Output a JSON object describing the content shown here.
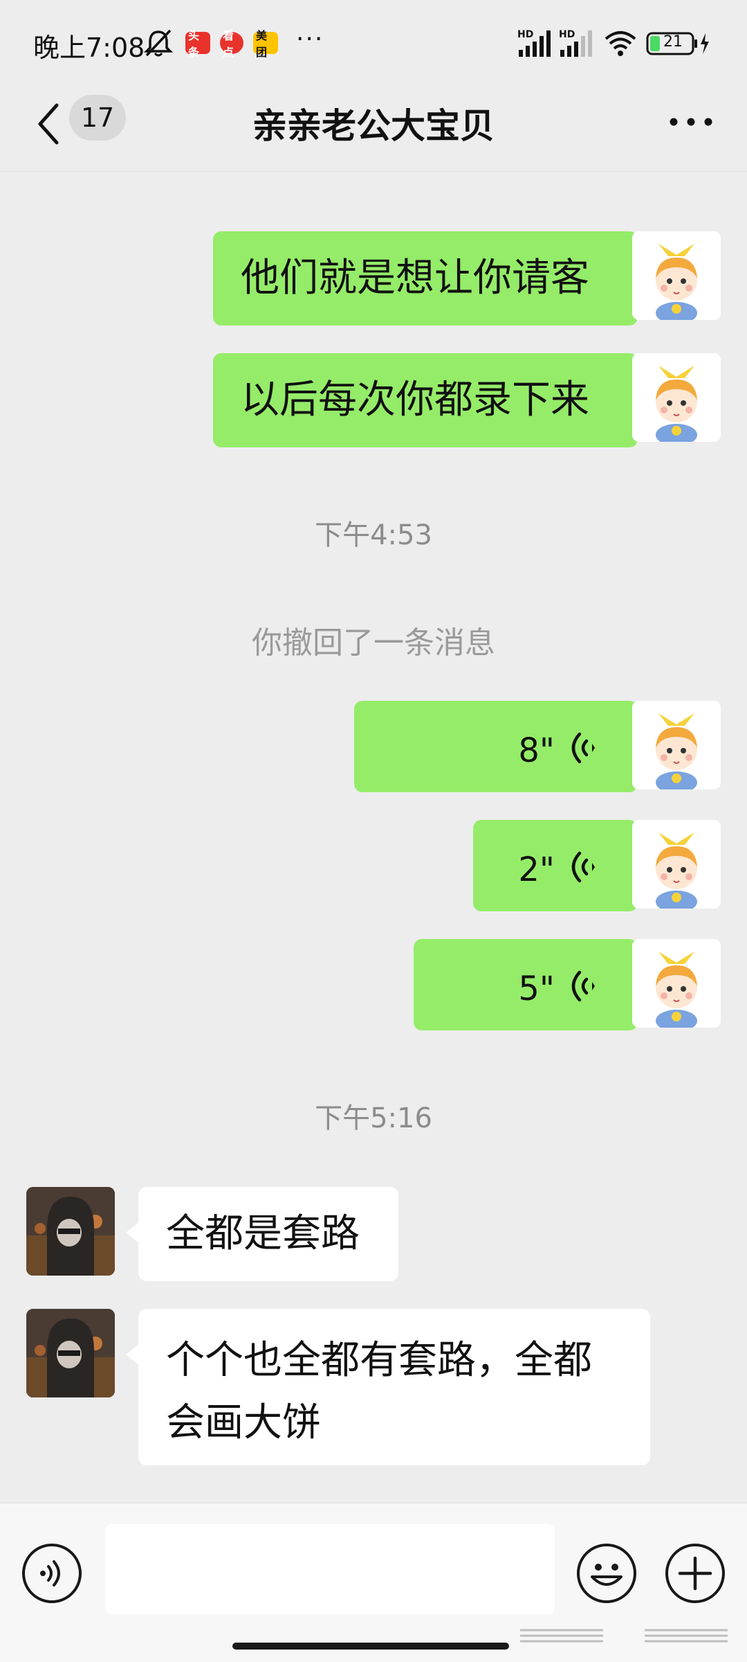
{
  "status_bar": {
    "time": "晚上7:08",
    "app_badges": [
      "头条",
      "看点",
      "美团"
    ],
    "more": "···",
    "battery": "21",
    "network_1": "HD",
    "network_2": "HD"
  },
  "nav": {
    "unread_count": "17",
    "title": "亲亲老公大宝贝"
  },
  "messages": [
    {
      "side": "me",
      "type": "text",
      "text": "他们就是想让你请客"
    },
    {
      "side": "me",
      "type": "text",
      "text": "以后每次你都录下来"
    },
    {
      "type": "time",
      "text": "下午4:53"
    },
    {
      "type": "system",
      "text": "你撤回了一条消息"
    },
    {
      "side": "me",
      "type": "voice",
      "duration": "8\""
    },
    {
      "side": "me",
      "type": "voice",
      "duration": "2\""
    },
    {
      "side": "me",
      "type": "voice",
      "duration": "5\""
    },
    {
      "type": "time",
      "text": "下午5:16"
    },
    {
      "side": "them",
      "type": "text",
      "text": "全都是套路"
    },
    {
      "side": "them",
      "type": "text",
      "lines": [
        "个个也全都有套路，全都",
        "会画大饼"
      ]
    }
  ],
  "input_bar": {
    "placeholder": ""
  },
  "colors": {
    "my_bubble": "#95ec69",
    "their_bubble": "#ffffff",
    "background": "#ededed"
  },
  "icons": [
    "back-icon",
    "more-icon",
    "voice-wave-icon",
    "voice-input-icon",
    "emoji-icon",
    "plus-icon"
  ]
}
